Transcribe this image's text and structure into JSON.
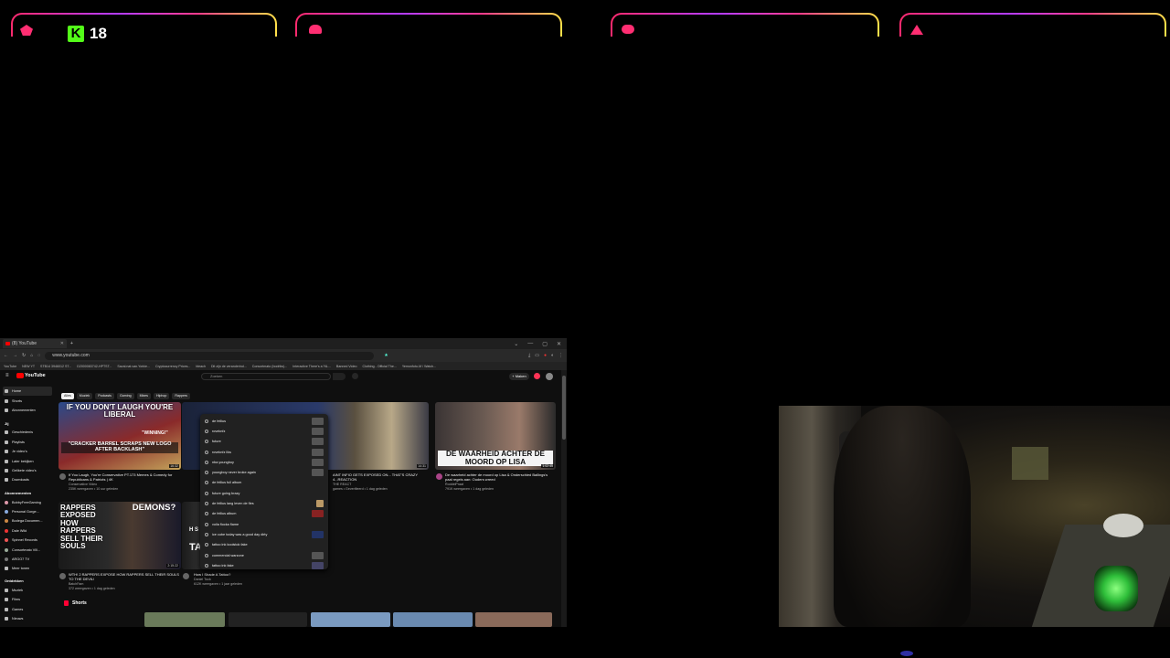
{
  "overlay": {
    "kick_viewer_count": "18",
    "frame_colors": [
      "#ff2a6d",
      "#b13cff",
      "#ffe14a"
    ],
    "kick_logo_letter": "K"
  },
  "browser": {
    "tab_title": "(8) YouTube",
    "new_tab_symbol": "+",
    "window_controls": [
      "⌄",
      "—",
      "▢",
      "✕"
    ],
    "url": "www.youtube.com",
    "bookmarks": [
      "YouTube",
      "NEW YT",
      "STB14 3946012 ST...",
      "D2000083742-HPTST...",
      "Saval.nat.van.Yorkie...",
      "Cryptocurrency Prices...",
      "bleach",
      "Dit zijn de veranderind...",
      "Consortmato (bodriks)...",
      "Interactive There's a 'NL...",
      "Banned Video",
      "Clothing - Official The...",
      "Yemonfoto-M / Watch..."
    ]
  },
  "youtube": {
    "logo_text": "YouTube",
    "search_placeholder": "Zoeken",
    "create_label": "+ Maken",
    "sidebar": {
      "main": [
        "Home",
        "Shorts",
        "Abonnementen"
      ],
      "you_header": "Jij",
      "you_items": [
        "Geschiedenis",
        "Playlists",
        "Je video's",
        "Later bekijken",
        "Gelikete video's",
        "Downloads"
      ],
      "subs_header": "Abonnementen",
      "subs": [
        "BobbyFreeGaming",
        "Personal Gorge...",
        "Bodega Documen...",
        "Dale Wild",
        "Spinnel Records",
        "Consortmato Vill...",
        "ARGO7 TV",
        "Meer tonen"
      ],
      "explore_header": "Ontdekken",
      "explore": [
        "Muziek",
        "Films",
        "Games",
        "Nieuws"
      ]
    },
    "chips": [
      "Alles",
      "Muziek",
      "Podcasts",
      "Gaming",
      "Mixes",
      "Hiphop",
      "Rappers"
    ],
    "suggestions": [
      "de fellius",
      "roveknfz",
      "future",
      "roveknfz liks",
      "nba youngboy",
      "youngboy never broke again",
      "de fellius full album",
      "future going brazy",
      "de fellius lang leven de fles",
      "de fellius album",
      "voila flocka flame",
      "ice cube today was a good day dirty",
      "tattoo ink koolstok fake",
      "commercial warzone",
      "tattoo ink fake"
    ],
    "videos": [
      {
        "thumb_text": "IF YOU DON'T LAUGH YOU'RE LIBERAL",
        "thumb_sub": "\"CRACKER BARREL SCRAPS NEW LOGO AFTER BACKLASH\"",
        "thumb_badge": "\"WINNING!\"",
        "duration": "16:32",
        "title": "If You Laugh, You're Conservative PT.173 Memes & Comedy for Republicans & Patriots | 4K",
        "channel": "Conservative Video",
        "meta": "235K weergaven • 10 uur geleden"
      },
      {
        "thumb_text": "",
        "duration": "14:31",
        "title": "AINT INFIO GETS EXPOSED ON... THAT'S CRAZY 4...REACTION",
        "channel": "THE REACT",
        "meta": "games • Geverifieerd • 1 dag geleden"
      },
      {
        "thumb_text": "DE WAARHEID ACHTER DE MOORD OP LISA",
        "duration": "1:02:45",
        "title": "De waarheid achter de moord op Lisa & Onderschied Ballings's paal regels aan: Ouders wreed",
        "channel": "RoddelPraat",
        "meta": "791K weergaven • 1 dag geleden"
      },
      {
        "thumb_text": "RAPPERS EXPOSED HOW RAPPERS SELL THEIR SOULS",
        "thumb_badge": "DEMONS?",
        "duration": "2:15:22",
        "title": "WTH! 2 RAPPERS EXPOSE HOW RAPPERS SELL THEIR SOULS TO THE DEVIL!",
        "channel": "BatchFam",
        "meta": "372 weergaven • 1 dag geleden"
      },
      {
        "thumb_text": "TATTOO",
        "thumb_badge": "H S",
        "duration": "12:44",
        "title": "How I Shade A Tattoo?",
        "channel": "Daniel Tuck",
        "meta": "612K weergaven • 1 jaar geleden"
      }
    ],
    "shorts_label": "Shorts"
  },
  "colors": {
    "yt_red": "#ff0000",
    "kick_green": "#53fc18",
    "overlay_pink": "#ff2e72"
  }
}
